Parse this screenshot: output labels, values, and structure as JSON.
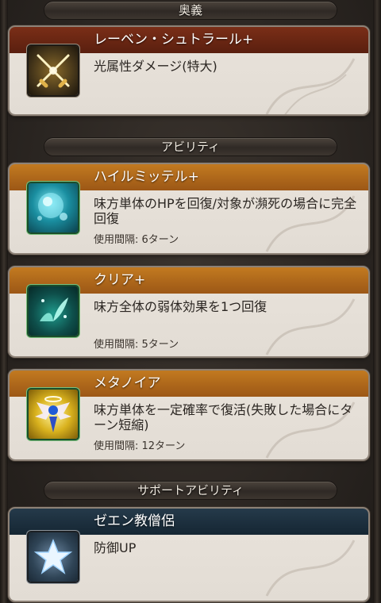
{
  "sections": {
    "ougi": "奥義",
    "abilities": "アビリティ",
    "support": "サポートアビリティ"
  },
  "ougi": {
    "name": "レーベン・シュトラール+",
    "description": "光属性ダメージ(特大)",
    "icon": "crossed-swords-icon"
  },
  "abilities": [
    {
      "name": "ハイルミッテル+",
      "description": "味方単体のHPを回復/対象が瀕死の場合に完全回復",
      "cooldown": "使用間隔: 6ターン",
      "icon": "water-orb-icon"
    },
    {
      "name": "クリア+",
      "description": "味方全体の弱体効果を1つ回復",
      "cooldown": "使用間隔: 5ターン",
      "icon": "leaf-sprout-icon"
    },
    {
      "name": "メタノイア",
      "description": "味方単体を一定確率で復活(失敗した場合にターン短縮)",
      "cooldown": "使用間隔: 12ターン",
      "icon": "winged-angel-icon"
    }
  ],
  "support": {
    "name": "ゼエン教僧侶",
    "description": "防御UP",
    "icon": "star-icon"
  },
  "colors": {
    "ougi_bar": "#6b2714",
    "ability_bar": "#b06c1c",
    "support_bar": "#1d3141",
    "card_bg": "#e2dcd4"
  }
}
